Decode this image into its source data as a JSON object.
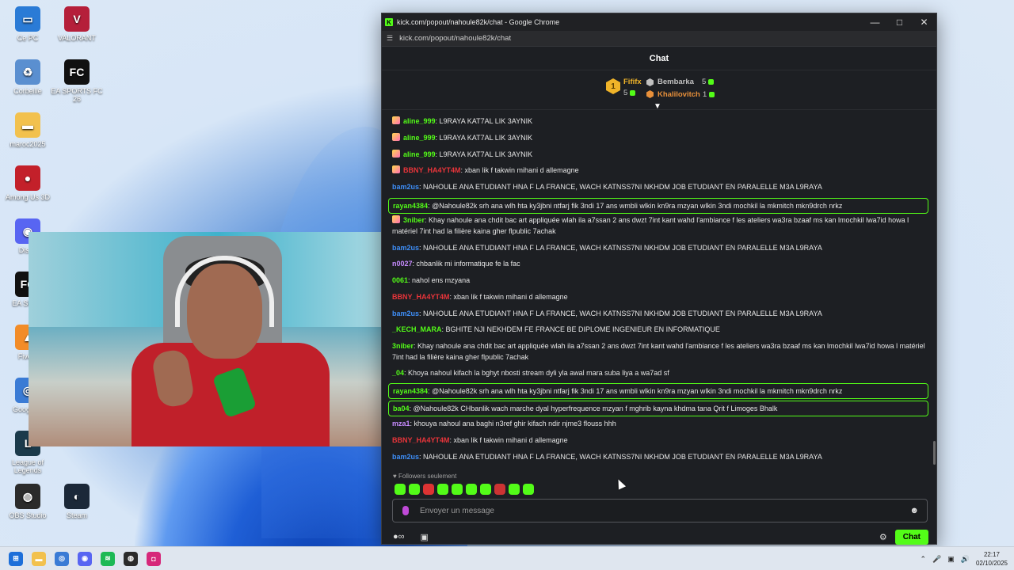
{
  "desktop_icons": [
    {
      "label": "Ce PC",
      "color": "#2a7bd6",
      "glyph": "▭"
    },
    {
      "label": "VALORANT",
      "color": "#b51f3a",
      "glyph": "V"
    },
    {
      "label": "Corbeille",
      "color": "#5a8fd0",
      "glyph": "♻"
    },
    {
      "label": "EA SPORTS FC 26",
      "color": "#111111",
      "glyph": "FC"
    },
    {
      "label": "maroc2025",
      "color": "#f2c14e",
      "glyph": "▬"
    },
    {
      "label": "Among Us 3D",
      "color": "#c3202a",
      "glyph": "●"
    },
    {
      "label": "Disco",
      "color": "#5865f2",
      "glyph": "◉"
    },
    {
      "label": "EA SPOR",
      "color": "#111111",
      "glyph": "FC"
    },
    {
      "label": "FiveM",
      "color": "#f28c28",
      "glyph": "▲"
    },
    {
      "label": "Google C",
      "color": "#3a7bd5",
      "glyph": "◎"
    },
    {
      "label": "League of Legends",
      "color": "#1b3a4b",
      "glyph": "L"
    },
    {
      "label": "OBS Studio",
      "color": "#2b2b2b",
      "glyph": "◍"
    },
    {
      "label": "Steam",
      "color": "#1b2838",
      "glyph": "◐"
    }
  ],
  "browser": {
    "title": "kick.com/popout/nahoule82k/chat - Google Chrome",
    "url": "kick.com/popout/nahoule82k/chat",
    "favicon": "K"
  },
  "chat": {
    "header": "Chat",
    "leaderboard": [
      {
        "name": "Fififx",
        "count": "5",
        "color": "#f0b429"
      },
      {
        "name": "Bembarka",
        "count": "5",
        "color": "#c0c0c0"
      },
      {
        "name": "Khalilovitch",
        "count": "1",
        "color": "#e8903a"
      }
    ],
    "rank_one": "1",
    "messages": [
      {
        "user": "aline_999",
        "color": "#53fc18",
        "text": "L9RAYA KAT7AL LIK 3AYNIK",
        "badge": true
      },
      {
        "user": "aline_999",
        "color": "#53fc18",
        "text": "L9RAYA KAT7AL LIK 3AYNIK",
        "badge": true
      },
      {
        "user": "aline_999",
        "color": "#53fc18",
        "text": "L9RAYA KAT7AL LIK 3AYNIK",
        "badge": true
      },
      {
        "user": "BBNY_HA4YT4M",
        "color": "#e8343a",
        "text": "xban lik f takwin mihani d allemagne",
        "badge": true
      },
      {
        "user": "bam2us",
        "color": "#3e8ef7",
        "text": "NAHOULE ANA ETUDIANT HNA F LA FRANCE, WACH KATNSS7NI NKHDM JOB ETUDIANT EN PARALELLE M3A L9RAYA",
        "badge": false
      },
      {
        "user": "rayan4384",
        "color": "#53fc18",
        "text": "@Nahoule82k srh ana wlh hta ky3jbni ntfarj fik 3ndi 17 ans wmbli wlkin kn9ra mzyan wlkin 3ndi mochkil la mkmitch mkn9drch nrkz",
        "badge": false,
        "highlight": true
      },
      {
        "user": "3niber",
        "color": "#53fc18",
        "text": "Khay nahoule ana chdit bac art appliquée wlah ila a7ssan 2 ans dwzt 7int kant wahd l'ambiance f les ateliers wa3ra bzaaf ms kan lmochkil lwa7id howa l matériel 7int had la filière kaina gher flpublic 7achak",
        "badge": true
      },
      {
        "user": "bam2us",
        "color": "#3e8ef7",
        "text": "NAHOULE ANA ETUDIANT HNA F LA FRANCE, WACH KATNSS7NI NKHDM JOB ETUDIANT EN PARALELLE M3A L9RAYA",
        "badge": false
      },
      {
        "user": "n0027",
        "color": "#c78bff",
        "text": "chbanlik mi informatique fe la fac",
        "badge": false
      },
      {
        "user": "0061",
        "color": "#53fc18",
        "text": "nahol ens mzyana",
        "badge": false
      },
      {
        "user": "BBNY_HA4YT4M",
        "color": "#e8343a",
        "text": "xban lik f takwin mihani d allemagne",
        "badge": false
      },
      {
        "user": "bam2us",
        "color": "#3e8ef7",
        "text": "NAHOULE ANA ETUDIANT HNA F LA FRANCE, WACH KATNSS7NI NKHDM JOB ETUDIANT EN PARALELLE M3A L9RAYA",
        "badge": false
      },
      {
        "user": "_KECH_MARA",
        "color": "#53fc18",
        "text": "BGHITE NJI NEKHDEM FE FRANCE BE DIPLOME INGENIEUR EN INFORMATIQUE",
        "badge": false
      },
      {
        "user": "3niber",
        "color": "#53fc18",
        "text": "Khay nahoule ana chdit bac art appliquée wlah ila a7ssan 2 ans dwzt 7int kant wahd l'ambiance f les ateliers wa3ra bzaaf ms kan lmochkil lwa7id howa l matériel 7int had la filière kaina gher flpublic 7achak",
        "badge": false
      },
      {
        "user": "_04",
        "color": "#53fc18",
        "text": "Khoya nahoul kifach la bghyt nbosti stream dyli yla awal mara suba liya a wa7ad sf",
        "badge": false
      },
      {
        "user": "rayan4384",
        "color": "#53fc18",
        "text": "@Nahoule82k srh ana wlh hta ky3jbni ntfarj fik 3ndi 17 ans wmbli wlkin kn9ra mzyan wlkin 3ndi mochkil la mkmitch mkn9drch nrkz",
        "badge": false,
        "highlight": true
      },
      {
        "user": "ba04",
        "color": "#53fc18",
        "text": "@Nahoule82k CHbanlik wach marche dyal hyperfrequence mzyan f mghrib kayna khdma tana Qrit f Limoges Bhalk",
        "badge": false,
        "highlight": true
      },
      {
        "user": "mza1",
        "color": "#c78bff",
        "text": "khouya nahoul ana baghi n3ref ghir kifach ndir njme3 flouss hhh",
        "badge": false
      },
      {
        "user": "BBNY_HA4YT4M",
        "color": "#e8343a",
        "text": "xban lik f takwin mihani d allemagne",
        "badge": false
      },
      {
        "user": "bam2us",
        "color": "#3e8ef7",
        "text": "NAHOULE ANA ETUDIANT HNA F LA FRANCE, WACH KATNSS7NI NKHDM JOB ETUDIANT EN PARALELLE M3A L9RAYA",
        "badge": false
      }
    ],
    "followers_only": "Followers seulement",
    "input_placeholder": "Envoyer un message",
    "chat_button": "Chat"
  },
  "taskbar": {
    "apps": [
      {
        "name": "windows-start",
        "color": "#1e6fd9",
        "glyph": "⊞"
      },
      {
        "name": "file-explorer",
        "color": "#f2c14e",
        "glyph": "▬"
      },
      {
        "name": "chrome",
        "color": "#3a7bd5",
        "glyph": "◎"
      },
      {
        "name": "discord",
        "color": "#5865f2",
        "glyph": "◉"
      },
      {
        "name": "spotify",
        "color": "#1db954",
        "glyph": "≋"
      },
      {
        "name": "obs",
        "color": "#2b2b2b",
        "glyph": "◍"
      },
      {
        "name": "instagram",
        "color": "#d6287a",
        "glyph": "◘"
      }
    ],
    "time": "22:17",
    "date": "02/10/2025"
  }
}
